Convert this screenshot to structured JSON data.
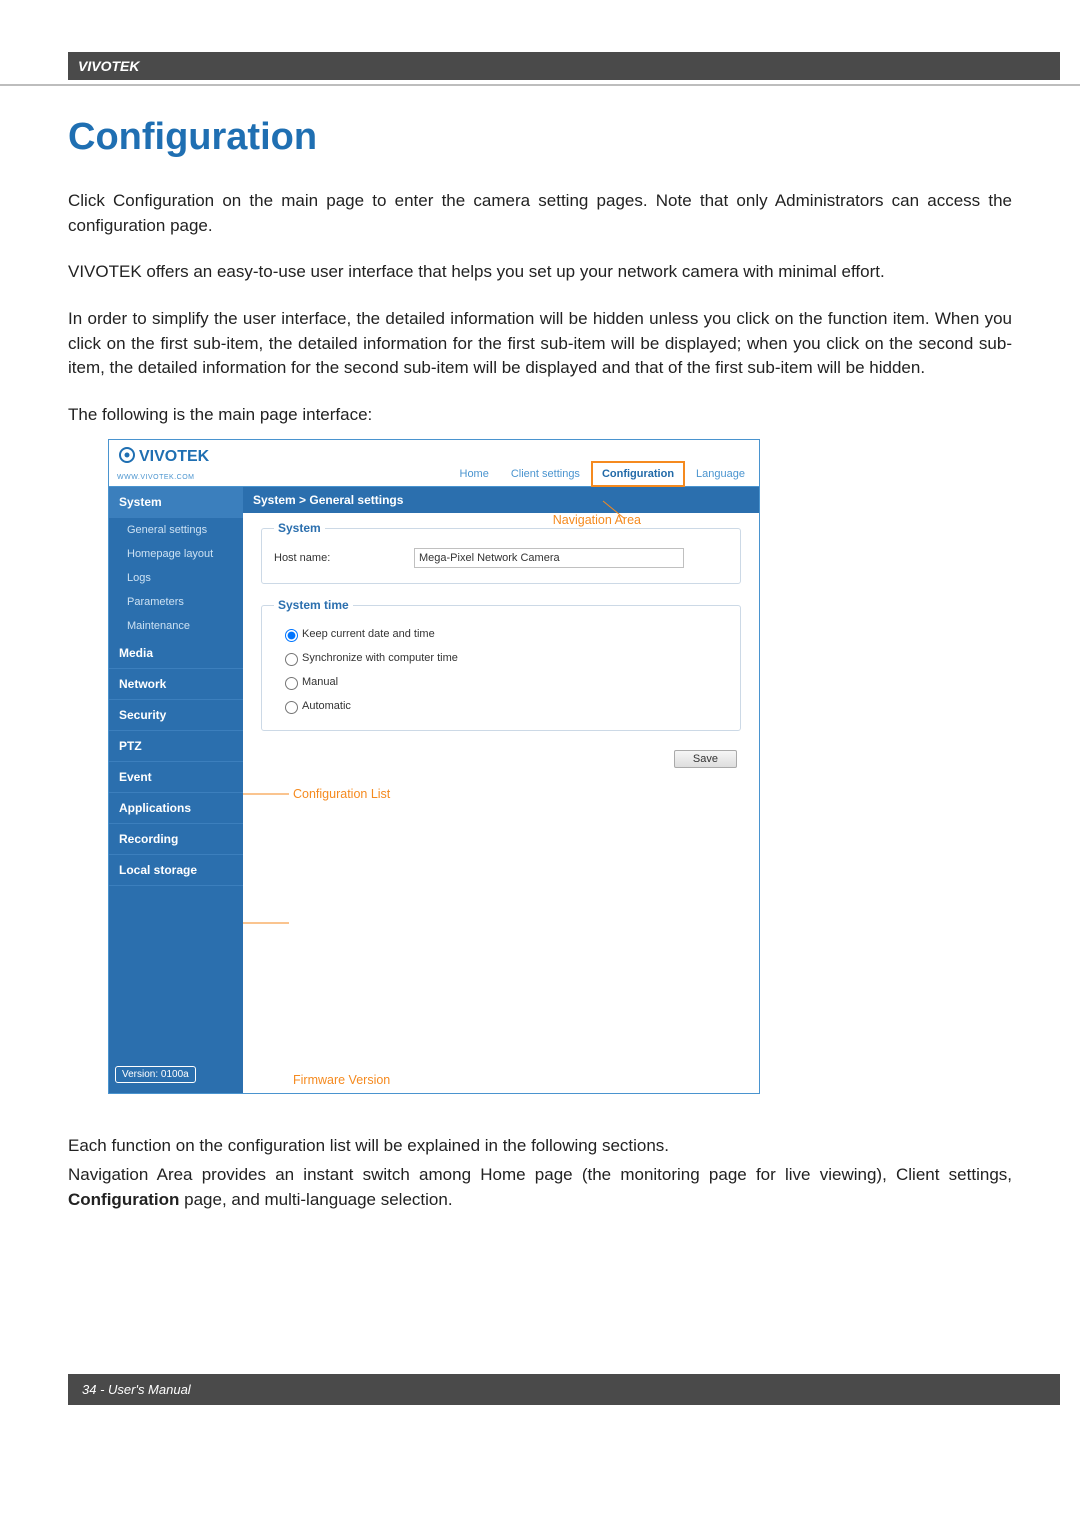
{
  "header": {
    "brand": "VIVOTEK"
  },
  "title": "Configuration",
  "paragraphs": {
    "p1": "Click Configuration on the main page to enter the camera setting pages. Note that only Administrators can access the configuration page.",
    "p2": "VIVOTEK offers an easy-to-use user interface that helps you set up your network camera with minimal effort.",
    "p3": "In order to simplify the user interface, the detailed information will be hidden unless you click on the function item. When you click on the first sub-item, the detailed information for the first sub-item will be displayed; when you click on the second sub-item, the detailed information for the second sub-item will be displayed and that of the first sub-item will be hidden.",
    "lead": "The following is the main page interface:",
    "after1": "Each function on the configuration list will be explained in the following sections.",
    "after2_a": "Navigation Area provides an instant switch among Home page (the monitoring page for live viewing), Client settings, ",
    "after2_b": "Configuration",
    "after2_c": " page, and multi-language selection."
  },
  "screenshot": {
    "logo_text": "VIVOTEK",
    "logo_sub": "WWW.VIVOTEK.COM",
    "tabs": [
      "Home",
      "Client settings",
      "Configuration",
      "Language"
    ],
    "breadcrumb": "System  >  General settings",
    "sidebar": {
      "system": "System",
      "subs": [
        "General settings",
        "Homepage layout",
        "Logs",
        "Parameters",
        "Maintenance"
      ],
      "cats": [
        "Media",
        "Network",
        "Security",
        "PTZ",
        "Event",
        "Applications",
        "Recording",
        "Local storage"
      ],
      "version": "Version: 0100a"
    },
    "panel": {
      "system_legend": "System",
      "hostname_label": "Host name:",
      "hostname_value": "Mega-Pixel Network Camera",
      "time_legend": "System time",
      "opts": [
        "Keep current date and time",
        "Synchronize with computer time",
        "Manual",
        "Automatic"
      ],
      "save": "Save"
    },
    "annotations": {
      "nav_area": "Navigation Area",
      "config_list": "Configuration List",
      "fw_version": "Firmware Version"
    }
  },
  "footer": {
    "text": "34 - User's Manual"
  }
}
